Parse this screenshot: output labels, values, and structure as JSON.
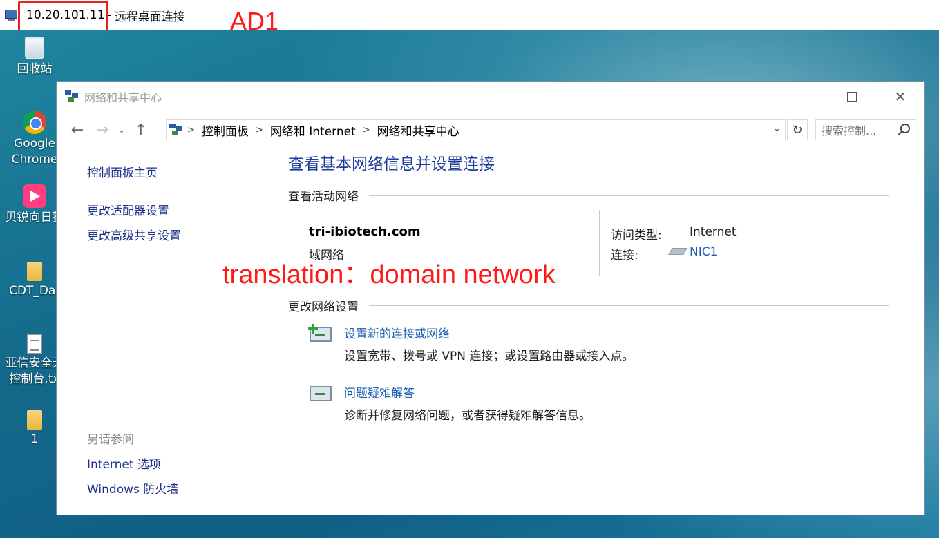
{
  "rdp": {
    "host": "10.20.101.11",
    "separator": "-",
    "title": "远程桌面连接",
    "annotation": "AD1"
  },
  "desktop": {
    "icons": [
      {
        "label": "回收站",
        "icon": "recycle-bin-icon"
      },
      {
        "label": "Google Chrome",
        "icon": "chrome-icon"
      },
      {
        "label": "贝锐向日葵",
        "icon": "sunlogin-icon"
      },
      {
        "label": "CDT_Dat",
        "icon": "folder-icon"
      },
      {
        "label": "亚信安全无控制台.tx",
        "icon": "text-file-icon"
      },
      {
        "label": "1",
        "icon": "folder-icon"
      }
    ]
  },
  "window": {
    "title": "网络和共享中心",
    "controls": {
      "minimize": "minimize",
      "maximize": "maximize",
      "close": "✕"
    }
  },
  "nav": {
    "back": "←",
    "forward": "→",
    "recent": "⌄",
    "up": "↑",
    "breadcrumb": [
      "控制面板",
      "网络和 Internet",
      "网络和共享中心"
    ],
    "refresh": "↻",
    "search_placeholder": "搜索控制..."
  },
  "sidebar": {
    "home": "控制面板主页",
    "links": [
      "更改适配器设置",
      "更改高级共享设置"
    ],
    "see_also_heading": "另请参阅",
    "see_also": [
      "Internet 选项",
      "Windows 防火墙"
    ]
  },
  "main": {
    "title": "查看基本网络信息并设置连接",
    "active_networks_heading": "查看活动网络",
    "network_name": "tri-ibiotech.com",
    "network_type": "域网络",
    "access_type_label": "访问类型:",
    "access_type_value": "Internet",
    "connection_label": "连接:",
    "connection_value": "NIC1",
    "change_settings_heading": "更改网络设置",
    "tasks": [
      {
        "title": "设置新的连接或网络",
        "desc": "设置宽带、拨号或 VPN 连接；或设置路由器或接入点。"
      },
      {
        "title": "问题疑难解答",
        "desc": "诊断并修复网络问题，或者获得疑难解答信息。"
      }
    ]
  },
  "annotation": {
    "translation": "translation：domain network"
  },
  "colors": {
    "annotation_red": "#ff1a1a",
    "link_blue": "#1e5fb4",
    "title_blue": "#1e3c9a"
  }
}
